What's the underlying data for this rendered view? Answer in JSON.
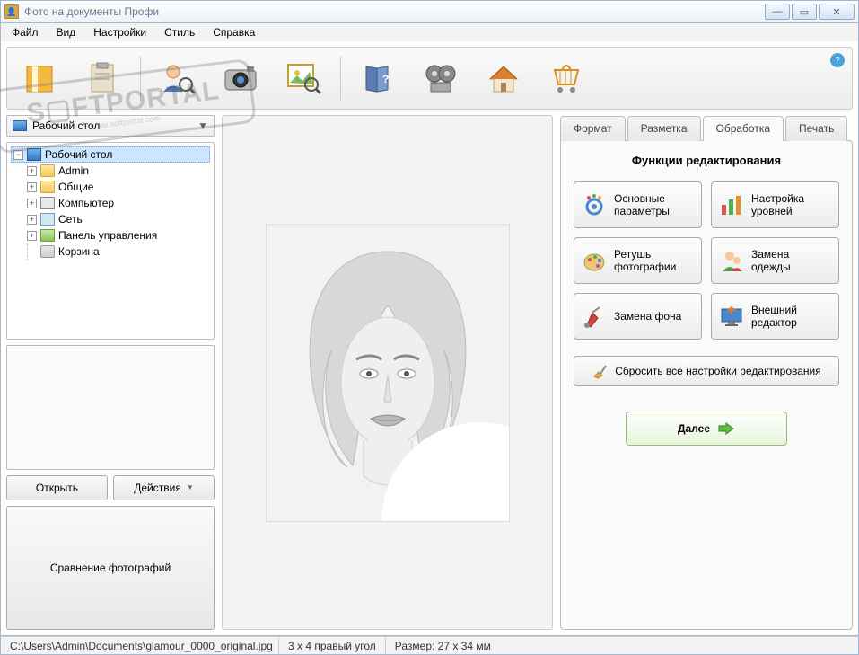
{
  "window": {
    "title": "Фото на документы Профи"
  },
  "menu": [
    "Файл",
    "Вид",
    "Настройки",
    "Стиль",
    "Справка"
  ],
  "stamp": {
    "line1": "S▢FTPORTAL",
    "line2": "www.softportal.com"
  },
  "toolbar_icons": [
    "package",
    "clipboard",
    "person-zoom",
    "camera",
    "image-zoom",
    "book-help",
    "film",
    "house",
    "cart"
  ],
  "combo": {
    "label": "Рабочий стол"
  },
  "tree": [
    {
      "label": "Рабочий стол",
      "icon": "desktop",
      "level": 0,
      "exp": "-",
      "sel": true
    },
    {
      "label": "Admin",
      "icon": "folder",
      "level": 1,
      "exp": "+"
    },
    {
      "label": "Общие",
      "icon": "folder",
      "level": 1,
      "exp": "+"
    },
    {
      "label": "Компьютер",
      "icon": "computer",
      "level": 1,
      "exp": "+"
    },
    {
      "label": "Сеть",
      "icon": "network",
      "level": 1,
      "exp": "+"
    },
    {
      "label": "Панель управления",
      "icon": "panel",
      "level": 1,
      "exp": "+"
    },
    {
      "label": "Корзина",
      "icon": "trash",
      "level": 1,
      "exp": ""
    }
  ],
  "left_buttons": {
    "open": "Открыть",
    "actions": "Действия",
    "compare": "Сравнение фотографий"
  },
  "tabs": [
    {
      "label": "Формат",
      "active": false
    },
    {
      "label": "Разметка",
      "active": false
    },
    {
      "label": "Обработка",
      "active": true
    },
    {
      "label": "Печать",
      "active": false
    }
  ],
  "editing": {
    "title": "Функции редактирования",
    "funcs": [
      {
        "label": "Основные параметры",
        "icon": "gear-color"
      },
      {
        "label": "Настройка уровней",
        "icon": "bars"
      },
      {
        "label": "Ретушь фотографии",
        "icon": "palette"
      },
      {
        "label": "Замена одежды",
        "icon": "avatar"
      },
      {
        "label": "Замена фона",
        "icon": "lamp"
      },
      {
        "label": "Внешний редактор",
        "icon": "monitor"
      }
    ],
    "reset": "Сбросить все настройки редактирования",
    "next": "Далее"
  },
  "status": {
    "path": "C:\\Users\\Admin\\Documents\\glamour_0000_original.jpg",
    "format": "3 x 4 правый угол",
    "size": "Размер: 27 x 34 мм"
  }
}
